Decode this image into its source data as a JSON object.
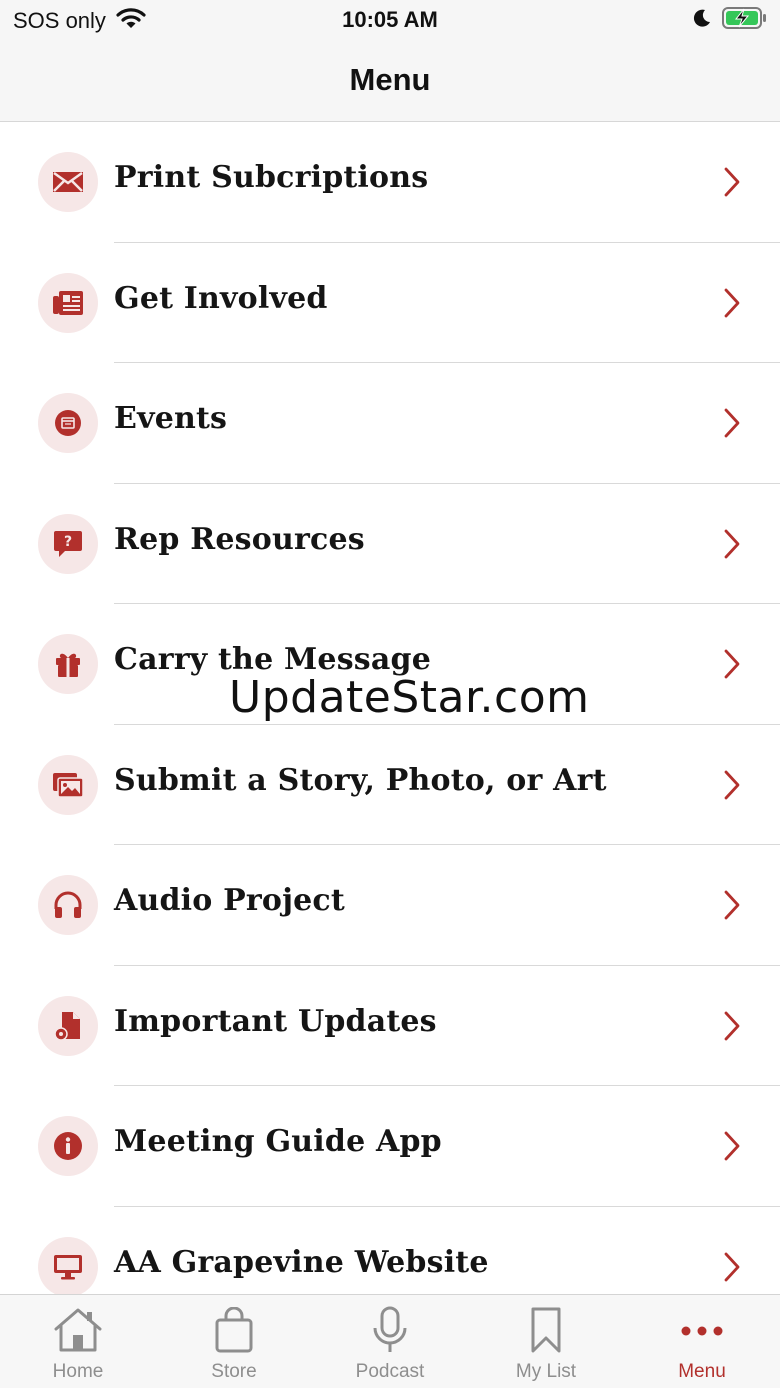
{
  "status_bar": {
    "carrier": "SOS only",
    "time": "10:05 AM"
  },
  "header": {
    "title": "Menu"
  },
  "accent_color": "#b2302c",
  "menu": {
    "items": [
      {
        "label": "Print Subcriptions",
        "icon": "envelope-icon"
      },
      {
        "label": "Get Involved",
        "icon": "newspaper-icon"
      },
      {
        "label": "Events",
        "icon": "calendar-icon"
      },
      {
        "label": "Rep Resources",
        "icon": "question-bubble-icon"
      },
      {
        "label": "Carry the Message",
        "icon": "gift-icon"
      },
      {
        "label": "Submit a Story, Photo, or Art",
        "icon": "photos-icon"
      },
      {
        "label": "Audio Project",
        "icon": "headphones-icon"
      },
      {
        "label": "Important Updates",
        "icon": "file-gear-icon"
      },
      {
        "label": "Meeting Guide App",
        "icon": "info-icon"
      },
      {
        "label": "AA Grapevine Website",
        "icon": "desktop-icon"
      }
    ]
  },
  "watermark": "UpdateStar.com",
  "tabbar": {
    "tabs": [
      {
        "label": "Home",
        "icon": "home-icon",
        "active": false
      },
      {
        "label": "Store",
        "icon": "shopping-bag-icon",
        "active": false
      },
      {
        "label": "Podcast",
        "icon": "microphone-icon",
        "active": false
      },
      {
        "label": "My List",
        "icon": "bookmark-icon",
        "active": false
      },
      {
        "label": "Menu",
        "icon": "more-dots-icon",
        "active": true
      }
    ]
  }
}
